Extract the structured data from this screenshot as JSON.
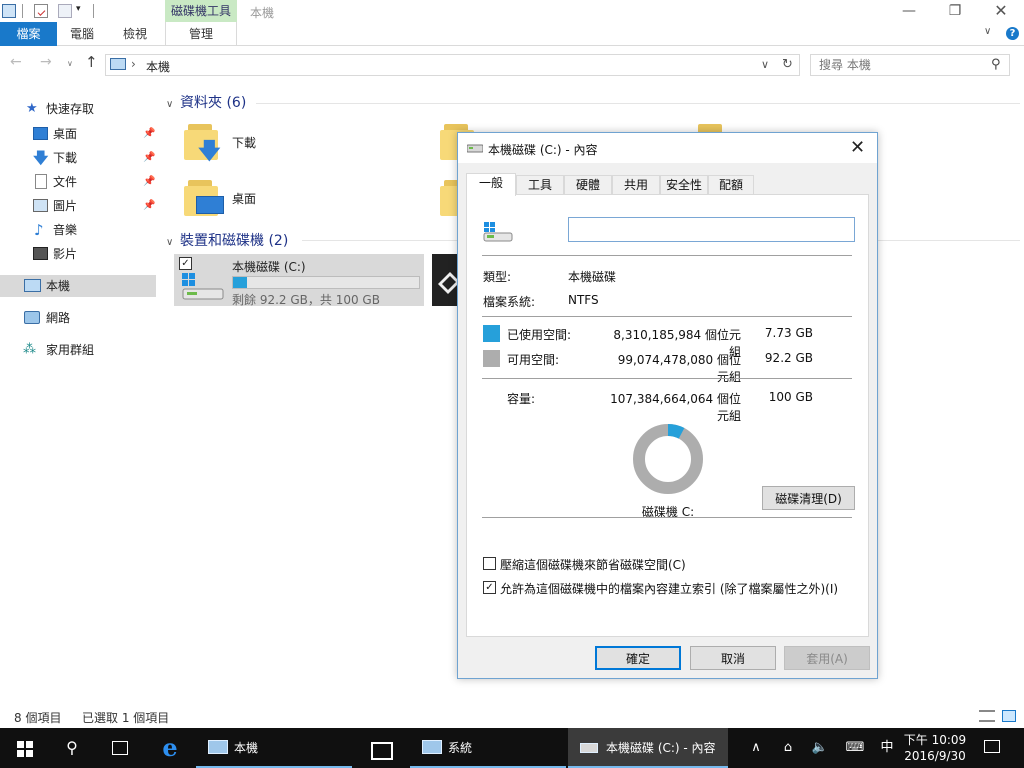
{
  "window": {
    "title": "本機",
    "context_tab_label": "磁碟機工具",
    "ribbon_tabs": [
      "檔案",
      "電腦",
      "檢視",
      "管理"
    ]
  },
  "address": {
    "path": "本機",
    "search_placeholder": "搜尋 本機"
  },
  "nav_pane": {
    "quick_access": "快速存取",
    "items": [
      {
        "label": "桌面",
        "icon": "desktop-icon",
        "pinned": true
      },
      {
        "label": "下載",
        "icon": "download-arrow-icon",
        "pinned": true
      },
      {
        "label": "文件",
        "icon": "document-icon",
        "pinned": true
      },
      {
        "label": "圖片",
        "icon": "picture-icon",
        "pinned": true
      },
      {
        "label": "音樂",
        "icon": "music-note-icon",
        "pinned": false
      },
      {
        "label": "影片",
        "icon": "film-icon",
        "pinned": false
      }
    ],
    "this_pc": "本機",
    "network": "網路",
    "homegroup": "家用群組"
  },
  "content": {
    "folders_header": "資料夾 (6)",
    "folders": [
      {
        "label": "下載",
        "overlay": "download"
      },
      {
        "label": "桌面",
        "overlay": "desktop"
      }
    ],
    "devices_header": "裝置和磁碟機 (2)",
    "drive_c": {
      "name": "本機磁碟 (C:)",
      "free_text": "剩餘 92.2 GB，共 100 GB",
      "used_fraction": 0.077
    }
  },
  "status_bar": {
    "item_count": "8 個項目",
    "selected": "已選取 1 個項目"
  },
  "dialog": {
    "title": "本機磁碟 (C:) - 內容",
    "tabs": [
      "一般",
      "工具",
      "硬體",
      "共用",
      "安全性",
      "配額"
    ],
    "volume_label": "",
    "type_label": "類型:",
    "type_value": "本機磁碟",
    "fs_label": "檔案系統:",
    "fs_value": "NTFS",
    "used": {
      "label": "已使用空間:",
      "bytes": "8,310,185,984 個位元組",
      "human": "7.73 GB",
      "color": "#26a0da"
    },
    "free": {
      "label": "可用空間:",
      "bytes": "99,074,478,080 個位元組",
      "human": "92.2 GB",
      "color": "#adadad"
    },
    "capacity": {
      "label": "容量:",
      "bytes": "107,384,664,064 個位元組",
      "human": "100 GB"
    },
    "used_fraction": 0.0774,
    "drive_caption": "磁碟機 C:",
    "cleanup_button": "磁碟清理(D)",
    "compress_label": "壓縮這個磁碟機來節省磁碟空間(C)",
    "compress_checked": false,
    "index_label": "允許為這個磁碟機中的檔案內容建立索引 (除了檔案屬性之外)(I)",
    "index_checked": true,
    "ok": "確定",
    "cancel": "取消",
    "apply": "套用(A)"
  },
  "taskbar": {
    "tasks": [
      "本機",
      "系統",
      "本機磁碟 (C:) - 內容"
    ],
    "ime": "中",
    "time": "下午 10:09",
    "date": "2016/9/30"
  }
}
